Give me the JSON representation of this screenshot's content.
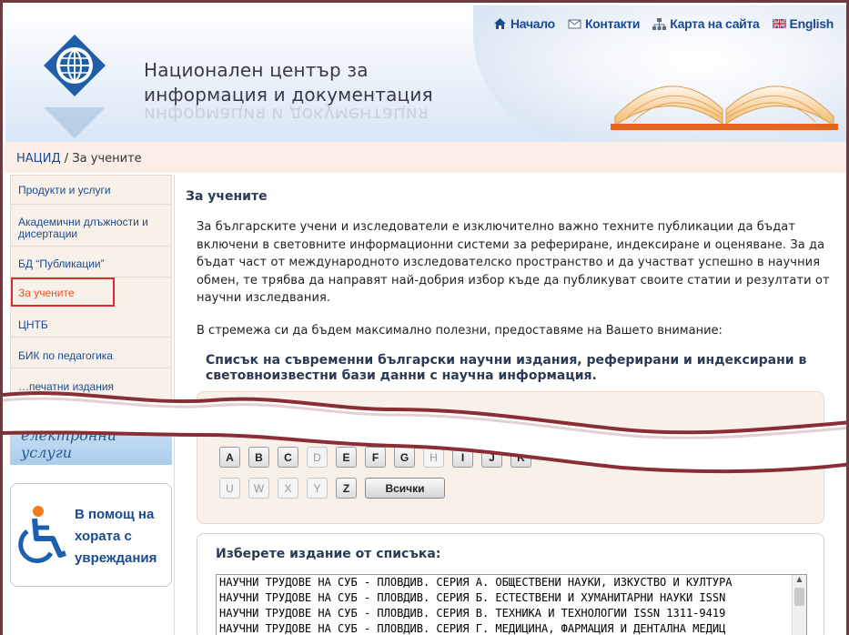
{
  "header": {
    "title_line1": "Национален център за",
    "title_line2": "информация и документация",
    "nav": [
      {
        "label": "Начало",
        "icon": "home-icon"
      },
      {
        "label": "Контакти",
        "icon": "mail-icon"
      },
      {
        "label": "Карта на сайта",
        "icon": "sitemap-icon"
      },
      {
        "label": "English",
        "icon": "uk-flag-icon"
      }
    ]
  },
  "breadcrumb": {
    "home": "НАЦИД",
    "separator": " / ",
    "current": "За учените"
  },
  "sidebar": {
    "items": [
      {
        "label": "Продукти и услуги"
      },
      {
        "label": "Академични длъжности и дисертации"
      },
      {
        "label": "БД “Публикации”"
      },
      {
        "label": "За учените",
        "active": true
      },
      {
        "label": "ЦНТБ"
      },
      {
        "label": "БИК по педагогика"
      },
      {
        "label": "…печатни издания"
      }
    ],
    "banner_label": "електронни услуги",
    "help_text_1": "В помощ на",
    "help_text_2": "хората с",
    "help_text_3": "увреждания"
  },
  "content": {
    "title": "За учените",
    "paragraph1": "За българските учени и изследователи е изключително важно техните публикации да бъдат включени в световните информационни системи за рефериране, индексиране и оценяване. За да бъдат част от международното изследователско пространство и да участват успешно в научния обмен, те трябва да направят най-добрия избор къде да публикуват своите статии и резултати от научни изследвания.",
    "paragraph2": "В стремежа си да бъдем максимално полезни, предоставяме на Вашето внимание:",
    "list_title": "Списък на съвременни български научни издания, реферирани и индексирани в световноизвестни бази данни с научна информация.",
    "alphabet_row1": [
      {
        "l": "A",
        "en": true
      },
      {
        "l": "B",
        "en": true
      },
      {
        "l": "C",
        "en": true
      },
      {
        "l": "D",
        "en": false
      },
      {
        "l": "E",
        "en": true
      },
      {
        "l": "F",
        "en": true
      },
      {
        "l": "G",
        "en": true
      },
      {
        "l": "H",
        "en": false
      },
      {
        "l": "I",
        "en": true
      },
      {
        "l": "J",
        "en": true
      },
      {
        "l": "K",
        "en": true
      }
    ],
    "alphabet_row2": [
      {
        "l": "U",
        "en": false
      },
      {
        "l": "W",
        "en": false
      },
      {
        "l": "X",
        "en": false
      },
      {
        "l": "Y",
        "en": false
      },
      {
        "l": "Z",
        "en": true
      }
    ],
    "all_label": "Всички",
    "select_title": "Изберете издание от списъка:",
    "options": [
      "НАУЧНИ ТРУДОВЕ НА СУБ - ПЛОВДИВ. СЕРИЯ А. ОБЩЕСТВЕНИ НАУКИ, ИЗКУСТВО И КУЛТУРА",
      "НАУЧНИ ТРУДОВЕ НА СУБ - ПЛОВДИВ. СЕРИЯ Б. ЕСТЕСТВЕНИ И ХУМАНИТАРНИ НАУКИ ISSN",
      "НАУЧНИ ТРУДОВЕ НА СУБ - ПЛОВДИВ. СЕРИЯ В. ТЕХНИКА И ТЕХНОЛОГИИ ISSN 1311-9419",
      "НАУЧНИ ТРУДОВЕ НА СУБ - ПЛОВДИВ. СЕРИЯ Г. МЕДИЦИНА, ФАРМАЦИЯ И ДЕНТАЛНА МЕДИЦ"
    ]
  }
}
